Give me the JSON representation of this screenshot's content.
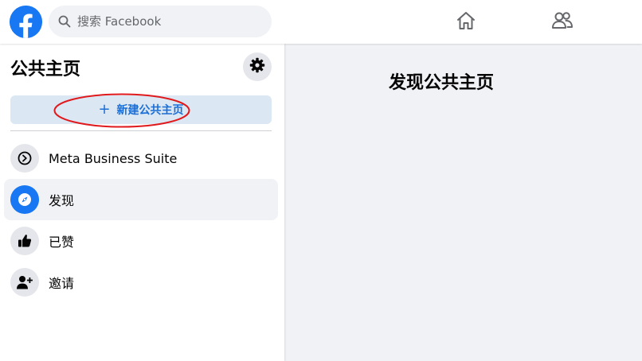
{
  "header": {
    "search": {
      "placeholder": "搜索 Facebook"
    },
    "nav": [
      {
        "icon": "home-icon"
      },
      {
        "icon": "friends-icon"
      }
    ],
    "brand_color": "#1877f2"
  },
  "sidebar": {
    "title": "公共主页",
    "settings_icon": "gear-icon",
    "create_button": {
      "icon": "plus-icon",
      "label": "新建公共主页"
    },
    "items": [
      {
        "label": "Meta Business Suite",
        "icon": "meta-business-suite-icon",
        "active": false
      },
      {
        "label": "发现",
        "icon": "compass-icon",
        "active": true
      },
      {
        "label": "已赞",
        "icon": "thumbs-up-icon",
        "active": false
      },
      {
        "label": "邀请",
        "icon": "person-add-icon",
        "active": false
      }
    ]
  },
  "main": {
    "title": "发现公共主页"
  },
  "annotation": {
    "shape": "ellipse",
    "color": "#e0191c",
    "target": "create-page-button"
  }
}
